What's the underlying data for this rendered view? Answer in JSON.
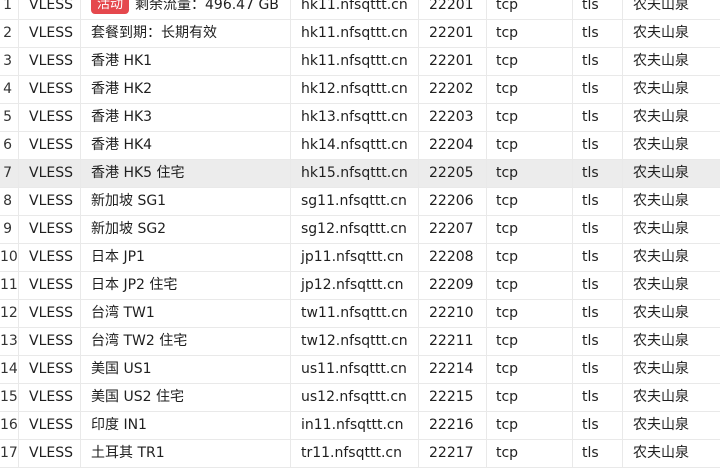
{
  "rows": [
    {
      "idx": "1",
      "type": "VLESS",
      "badge": "活动",
      "name": "剩余流量：496.47 GB",
      "host": "hk11.nfsqttt.cn",
      "port": "22201",
      "proto": "tcp",
      "tls": "tls",
      "group": "农夫山泉"
    },
    {
      "idx": "2",
      "type": "VLESS",
      "name": "套餐到期：长期有效",
      "host": "hk11.nfsqttt.cn",
      "port": "22201",
      "proto": "tcp",
      "tls": "tls",
      "group": "农夫山泉"
    },
    {
      "idx": "3",
      "type": "VLESS",
      "name": "香港 HK1",
      "host": "hk11.nfsqttt.cn",
      "port": "22201",
      "proto": "tcp",
      "tls": "tls",
      "group": "农夫山泉"
    },
    {
      "idx": "4",
      "type": "VLESS",
      "name": "香港 HK2",
      "host": "hk12.nfsqttt.cn",
      "port": "22202",
      "proto": "tcp",
      "tls": "tls",
      "group": "农夫山泉"
    },
    {
      "idx": "5",
      "type": "VLESS",
      "name": "香港 HK3",
      "host": "hk13.nfsqttt.cn",
      "port": "22203",
      "proto": "tcp",
      "tls": "tls",
      "group": "农夫山泉"
    },
    {
      "idx": "6",
      "type": "VLESS",
      "name": "香港 HK4",
      "host": "hk14.nfsqttt.cn",
      "port": "22204",
      "proto": "tcp",
      "tls": "tls",
      "group": "农夫山泉"
    },
    {
      "idx": "7",
      "type": "VLESS",
      "name": "香港 HK5 住宅",
      "host": "hk15.nfsqttt.cn",
      "port": "22205",
      "proto": "tcp",
      "tls": "tls",
      "group": "农夫山泉",
      "hovered": true
    },
    {
      "idx": "8",
      "type": "VLESS",
      "name": "新加坡 SG1",
      "host": "sg11.nfsqttt.cn",
      "port": "22206",
      "proto": "tcp",
      "tls": "tls",
      "group": "农夫山泉"
    },
    {
      "idx": "9",
      "type": "VLESS",
      "name": "新加坡 SG2",
      "host": "sg12.nfsqttt.cn",
      "port": "22207",
      "proto": "tcp",
      "tls": "tls",
      "group": "农夫山泉"
    },
    {
      "idx": "10",
      "type": "VLESS",
      "name": "日本 JP1",
      "host": "jp11.nfsqttt.cn",
      "port": "22208",
      "proto": "tcp",
      "tls": "tls",
      "group": "农夫山泉"
    },
    {
      "idx": "11",
      "type": "VLESS",
      "name": "日本 JP2 住宅",
      "host": "jp12.nfsqttt.cn",
      "port": "22209",
      "proto": "tcp",
      "tls": "tls",
      "group": "农夫山泉"
    },
    {
      "idx": "12",
      "type": "VLESS",
      "name": "台湾 TW1",
      "host": "tw11.nfsqttt.cn",
      "port": "22210",
      "proto": "tcp",
      "tls": "tls",
      "group": "农夫山泉"
    },
    {
      "idx": "13",
      "type": "VLESS",
      "name": "台湾 TW2 住宅",
      "host": "tw12.nfsqttt.cn",
      "port": "22211",
      "proto": "tcp",
      "tls": "tls",
      "group": "农夫山泉"
    },
    {
      "idx": "14",
      "type": "VLESS",
      "name": "美国 US1",
      "host": "us11.nfsqttt.cn",
      "port": "22214",
      "proto": "tcp",
      "tls": "tls",
      "group": "农夫山泉"
    },
    {
      "idx": "15",
      "type": "VLESS",
      "name": "美国 US2 住宅",
      "host": "us12.nfsqttt.cn",
      "port": "22215",
      "proto": "tcp",
      "tls": "tls",
      "group": "农夫山泉"
    },
    {
      "idx": "16",
      "type": "VLESS",
      "name": "印度 IN1",
      "host": "in11.nfsqttt.cn",
      "port": "22216",
      "proto": "tcp",
      "tls": "tls",
      "group": "农夫山泉"
    },
    {
      "idx": "17",
      "type": "VLESS",
      "name": "土耳其 TR1",
      "host": "tr11.nfsqttt.cn",
      "port": "22217",
      "proto": "tcp",
      "tls": "tls",
      "group": "农夫山泉"
    }
  ],
  "colors": {
    "badge": "#e5484d",
    "hover_row": "#ececec",
    "grid": "#e9e9e9"
  }
}
